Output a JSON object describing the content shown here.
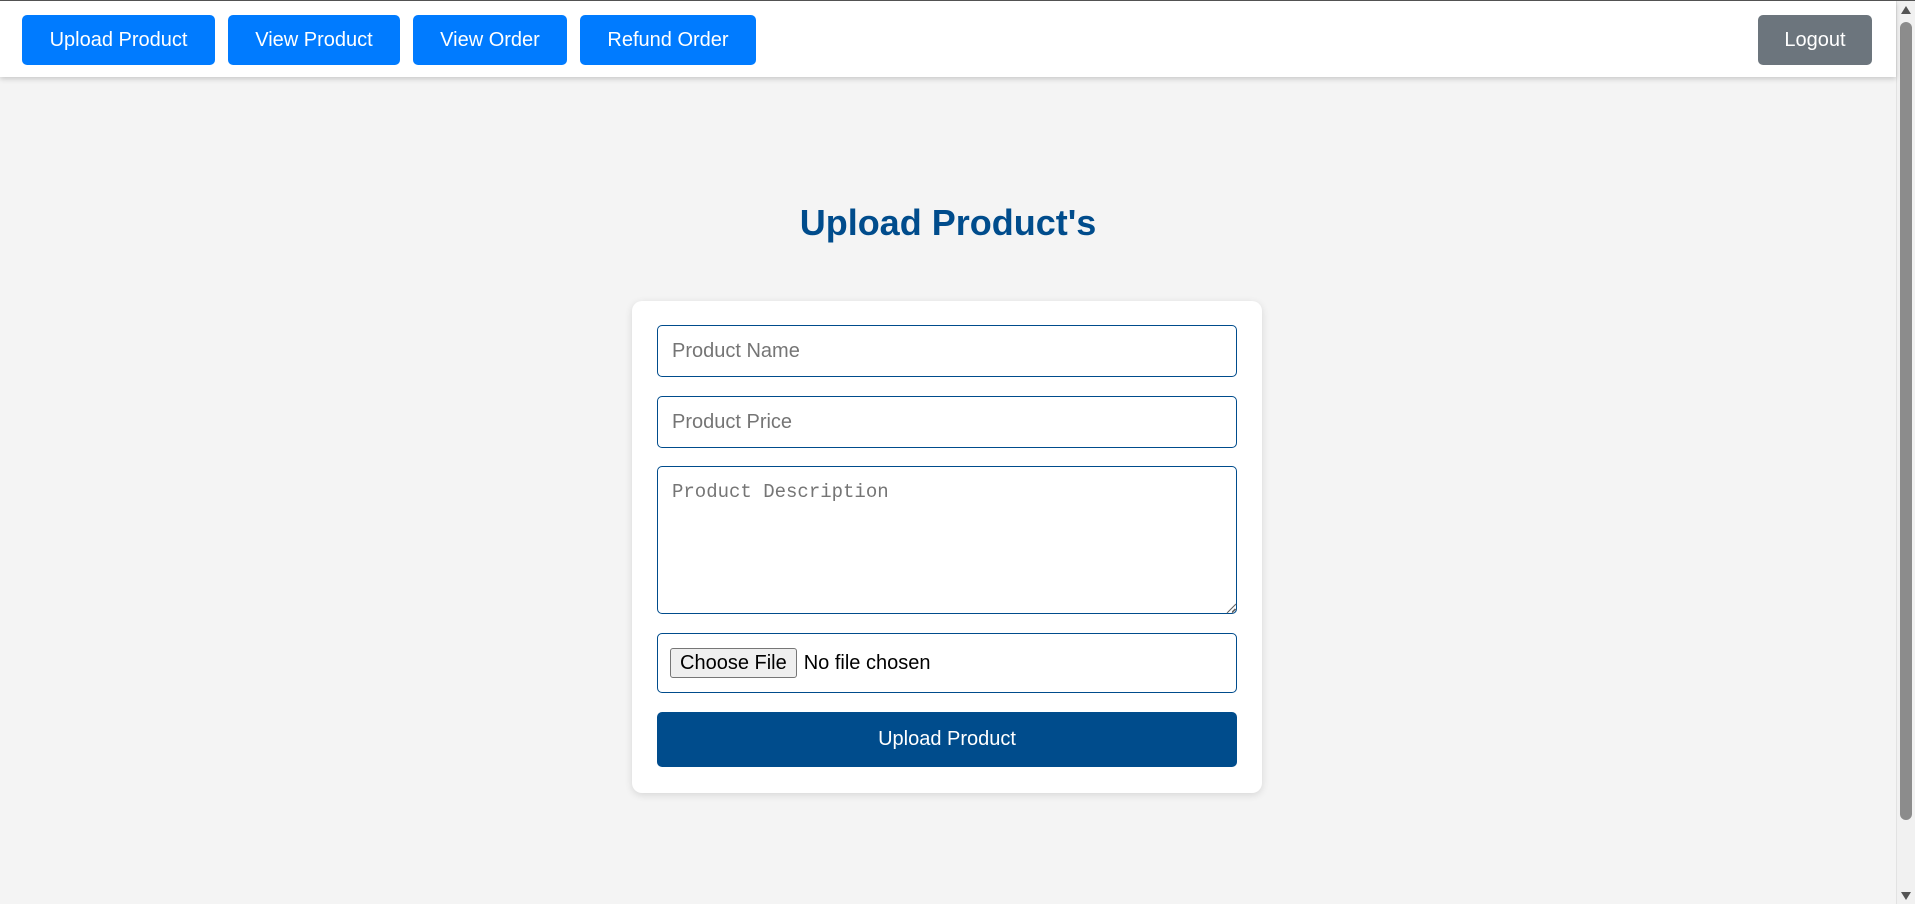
{
  "navbar": {
    "items": [
      {
        "label": "Upload Product"
      },
      {
        "label": "View Product"
      },
      {
        "label": "View Order"
      },
      {
        "label": "Refund Order"
      }
    ],
    "logout_label": "Logout",
    "primary_color": "#007bff",
    "logout_color": "#6c757d"
  },
  "main": {
    "title": "Upload Product's",
    "title_color": "#004c8c"
  },
  "form": {
    "product_name": {
      "placeholder": "Product Name",
      "value": ""
    },
    "product_price": {
      "placeholder": "Product Price",
      "value": ""
    },
    "product_description": {
      "placeholder": "Product Description",
      "value": ""
    },
    "file": {
      "button_label": "Choose File",
      "status": "No file chosen"
    },
    "submit_label": "Upload Product",
    "accent_color": "#004c8c"
  }
}
